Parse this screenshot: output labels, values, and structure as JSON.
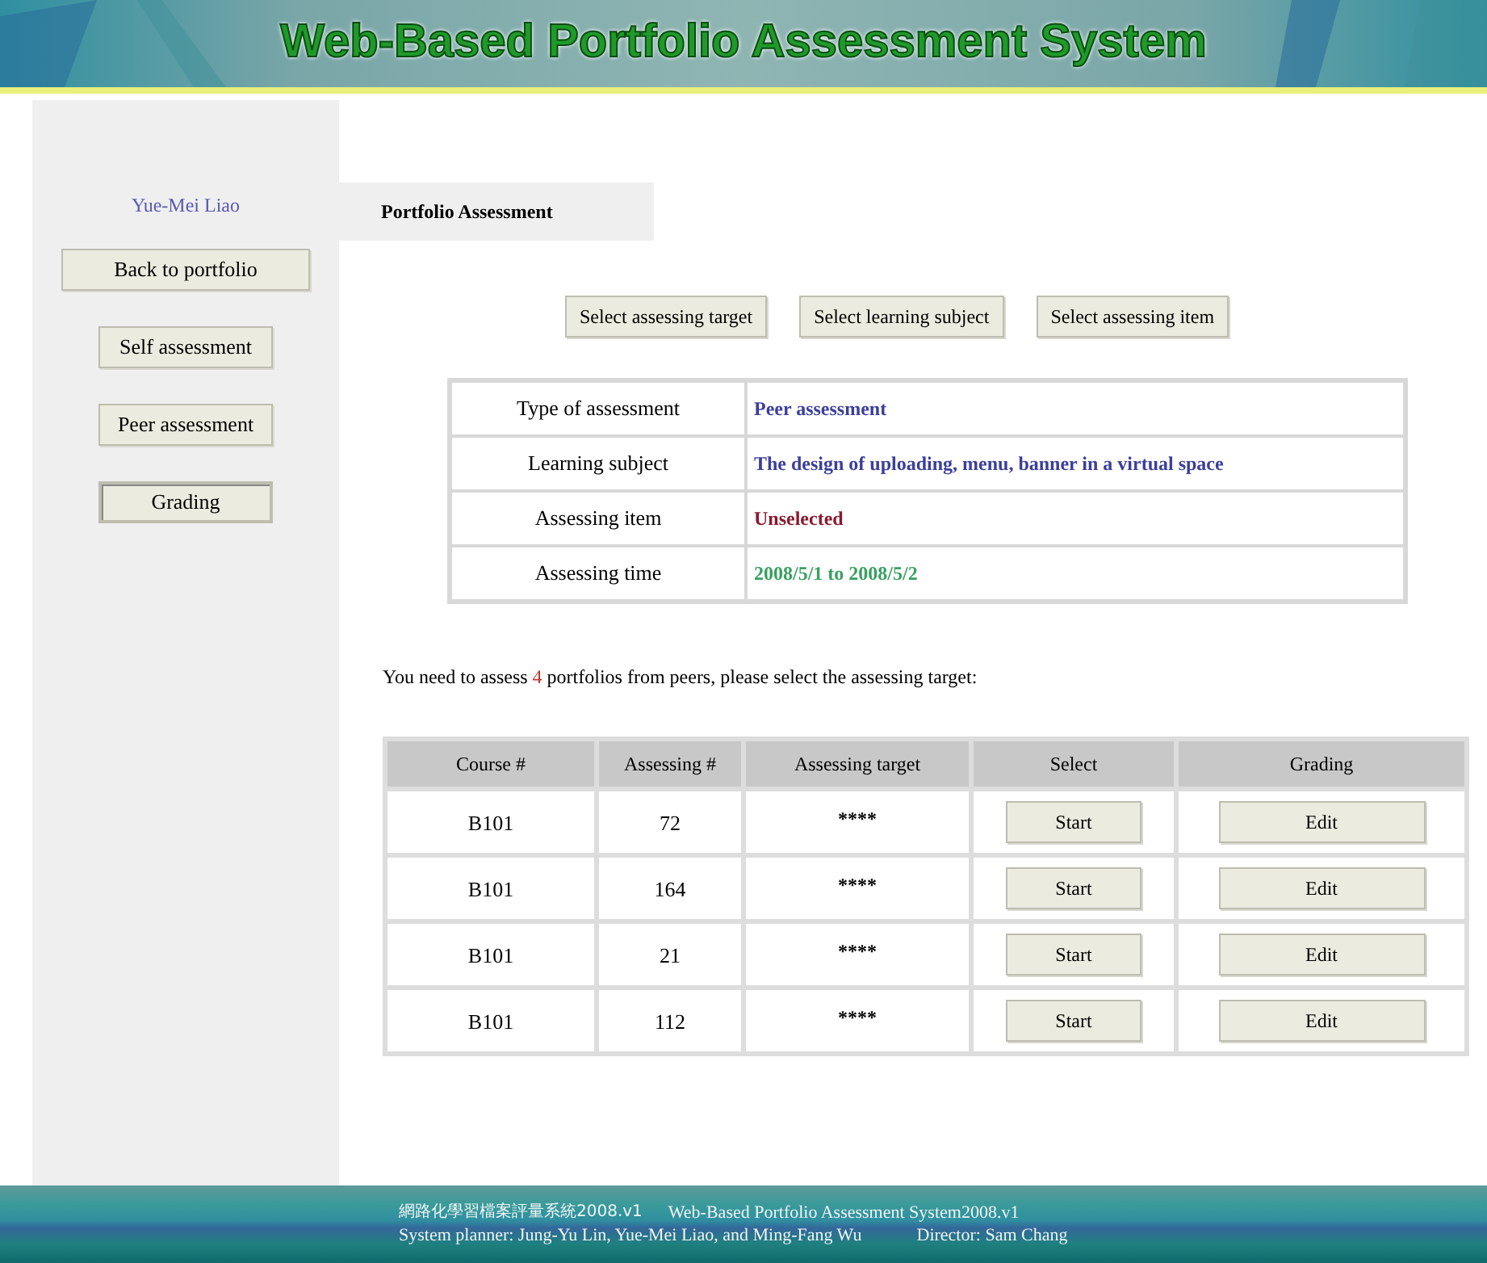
{
  "banner": {
    "title": "Web-Based Portfolio Assessment System"
  },
  "sidebar": {
    "user": "Yue-Mei Liao",
    "items": [
      {
        "label": "Back to portfolio",
        "selected": false
      },
      {
        "label": "Self assessment",
        "selected": false
      },
      {
        "label": "Peer assessment",
        "selected": false
      },
      {
        "label": "Grading",
        "selected": true
      }
    ]
  },
  "section_tab": "Portfolio Assessment",
  "toolbar": [
    "Select assessing target",
    "Select learning subject",
    "Select assessing item"
  ],
  "info": [
    {
      "label": "Type of assessment",
      "value": "Peer assessment",
      "color": "#3b3f9a"
    },
    {
      "label": "Learning subject",
      "value": "The design of uploading, menu, banner in a virtual space",
      "color": "#3b3f9a"
    },
    {
      "label": "Assessing item",
      "value": "Unselected",
      "color": "#8b1a2e"
    },
    {
      "label": "Assessing time",
      "value": "2008/5/1 to 2008/5/2",
      "color": "#3aa060"
    }
  ],
  "notice": {
    "prefix": "You need to assess ",
    "count": "4",
    "suffix": " portfolios from peers, please select the assessing target:"
  },
  "table": {
    "columns": [
      "Course #",
      "Assessing #",
      "Assessing target",
      "Select",
      "Grading"
    ],
    "rows": [
      {
        "course": "B101",
        "number": "72",
        "target": "****",
        "select": "Start",
        "grading": "Edit"
      },
      {
        "course": "B101",
        "number": "164",
        "target": "****",
        "select": "Start",
        "grading": "Edit"
      },
      {
        "course": "B101",
        "number": "21",
        "target": "****",
        "select": "Start",
        "grading": "Edit"
      },
      {
        "course": "B101",
        "number": "112",
        "target": "****",
        "select": "Start",
        "grading": "Edit"
      }
    ]
  },
  "footer": {
    "line_1": [
      "網路化學習檔案評量系統2008.v1",
      "Web-Based Portfolio Assessment System2008.v1"
    ],
    "line_2": [
      "System planner: Jung-Yu Lin, Yue-Mei Liao, and Ming-Fang Wu",
      "Director: Sam Chang"
    ]
  }
}
